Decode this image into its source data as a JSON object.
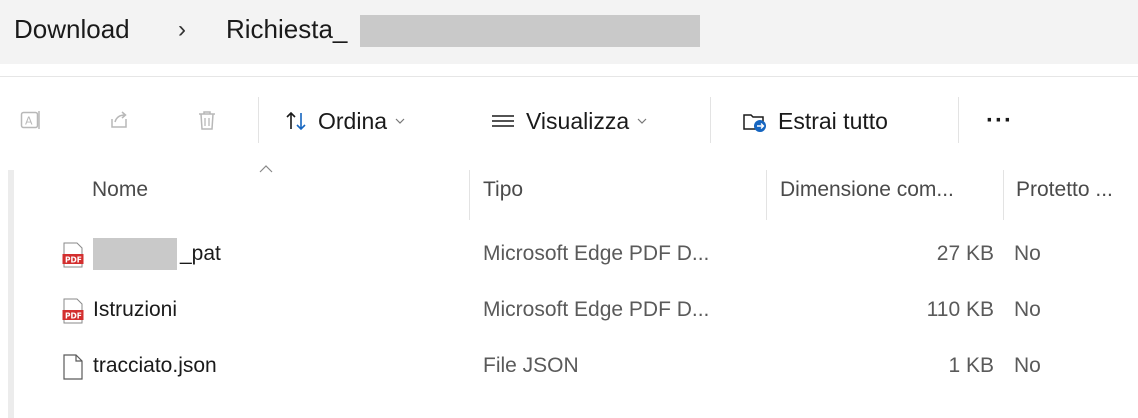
{
  "breadcrumb": {
    "items": [
      "Download",
      "Richiesta_"
    ],
    "separator": "›"
  },
  "toolbar": {
    "sort_label": "Ordina",
    "view_label": "Visualizza",
    "extract_label": "Estrai tutto",
    "more_label": "···"
  },
  "columns": {
    "name": "Nome",
    "type": "Tipo",
    "size": "Dimensione com...",
    "protected": "Protetto ..."
  },
  "files": [
    {
      "name": "_pat",
      "type": "Microsoft Edge PDF D...",
      "size": "27 KB",
      "protected": "No",
      "icon": "pdf-icon"
    },
    {
      "name": "Istruzioni",
      "type": "Microsoft Edge PDF D...",
      "size": "110 KB",
      "protected": "No",
      "icon": "pdf-icon"
    },
    {
      "name": "tracciato.json",
      "type": "File JSON",
      "size": "1 KB",
      "protected": "No",
      "icon": "file-icon"
    }
  ],
  "colors": {
    "pdf_red": "#d32f2f",
    "accent_blue": "#1565c0",
    "redaction": "#c9c9c9"
  }
}
